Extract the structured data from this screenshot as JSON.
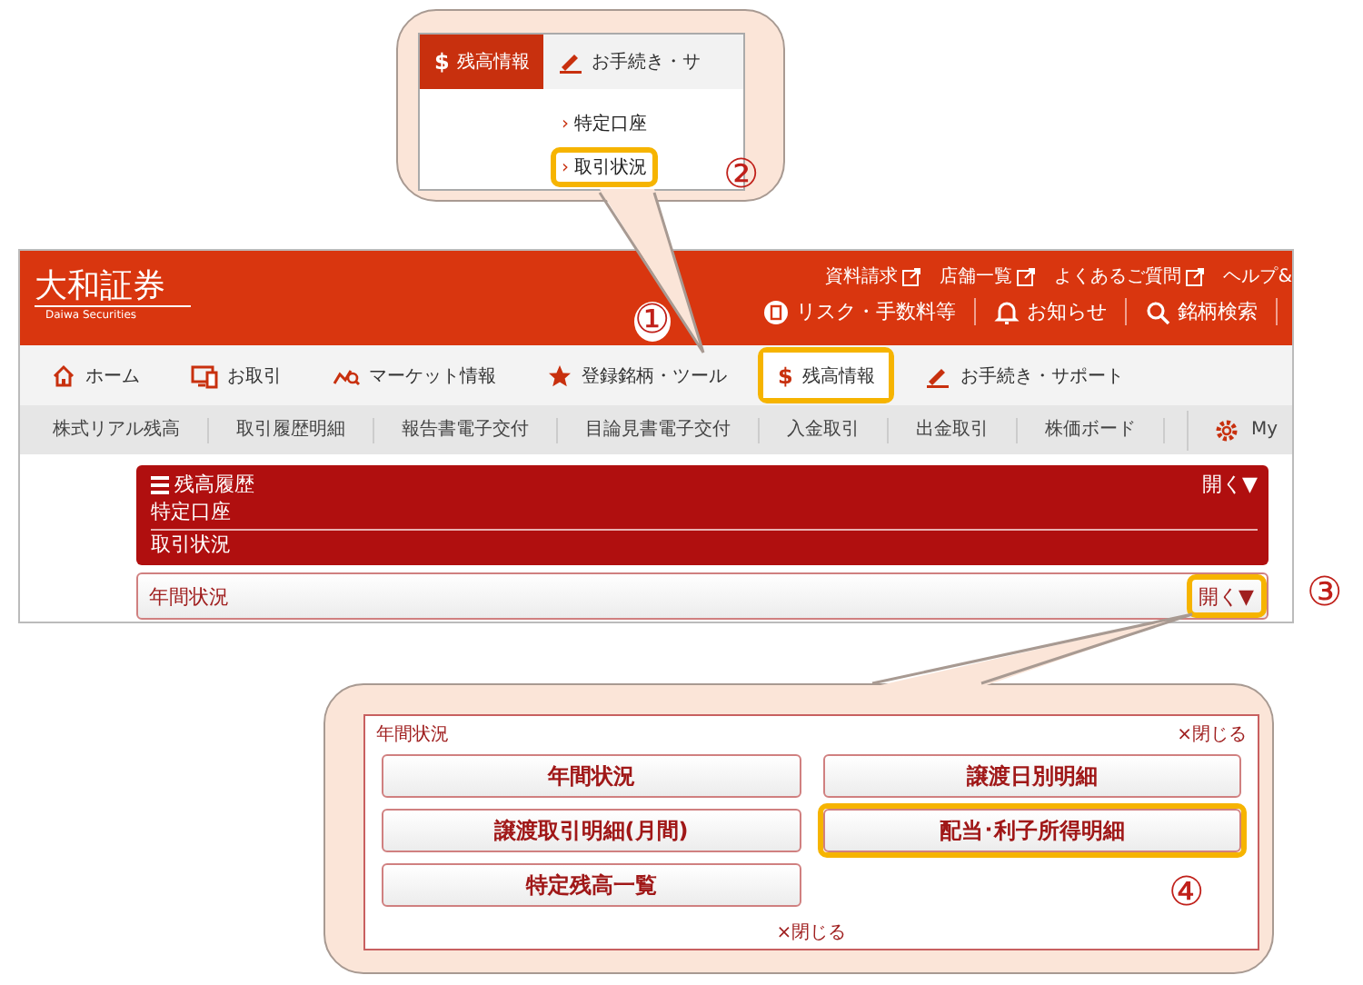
{
  "zoom_callout": {
    "tabs": [
      {
        "symbol": "$",
        "label": "残高情報",
        "selected": true
      },
      {
        "label": "お手続き・サ",
        "selected": false
      }
    ],
    "links": [
      {
        "marker": "›",
        "label": "特定口座",
        "highlighted": false
      },
      {
        "marker": "›",
        "label": "取引状況",
        "highlighted": true
      }
    ],
    "step": "②"
  },
  "site": {
    "logo": "大和証券",
    "logo_sub": "Daiwa Securities",
    "top_links": [
      "資料請求",
      "店舗一覧",
      "よくあるご質問",
      "ヘルプ&"
    ],
    "tools": [
      "リスク・手数料等",
      "お知らせ",
      "銘柄検索"
    ],
    "nav": [
      {
        "label": "ホーム",
        "highlighted": false
      },
      {
        "label": "お取引",
        "highlighted": false
      },
      {
        "label": "マーケット情報",
        "highlighted": false
      },
      {
        "label": "登録銘柄・ツール",
        "highlighted": false
      },
      {
        "symbol": "$",
        "label": "残高情報",
        "highlighted": true
      },
      {
        "label": "お手続き・サポート",
        "highlighted": false
      }
    ],
    "nav_step": "①",
    "subnav": [
      "株式リアル残高",
      "取引履歴明細",
      "報告書電子交付",
      "目論見書電子交付",
      "入金取引",
      "出金取引",
      "株価ボード"
    ],
    "my_link": "My",
    "history": {
      "title": "残高履歴",
      "toggle": "開く▼",
      "items": [
        "特定口座",
        "取引状況"
      ]
    },
    "annual": {
      "title": "年間状況",
      "toggle": "開く▼",
      "toggle_highlighted": true,
      "step": "③"
    }
  },
  "annual_callout": {
    "title": "年間状況",
    "close": "×閉じる",
    "buttons": [
      {
        "label": "年間状況",
        "highlighted": false
      },
      {
        "label": "譲渡日別明細",
        "highlighted": false
      },
      {
        "label": "譲渡取引明細(月間)",
        "highlighted": false
      },
      {
        "label": "配当･利子所得明細",
        "highlighted": true
      },
      {
        "label": "特定残高一覧",
        "highlighted": false
      }
    ],
    "bottom_close": "×閉じる",
    "step": "④"
  }
}
